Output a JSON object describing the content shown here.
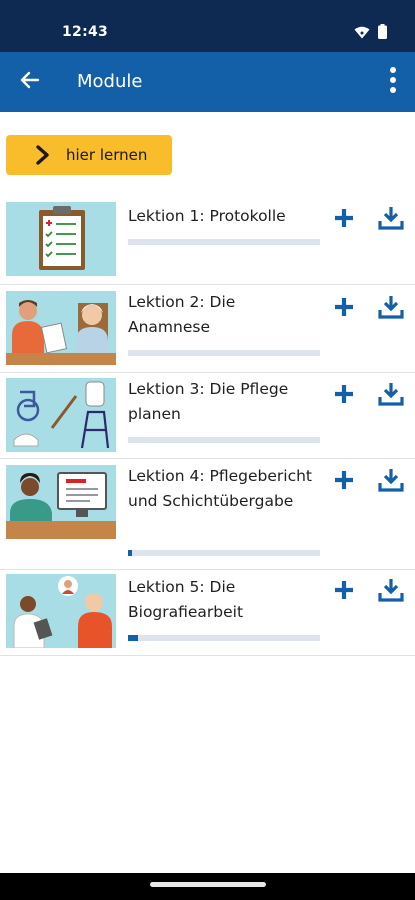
{
  "status_bar": {
    "time": "12:43",
    "icons": [
      "wifi-icon",
      "battery-icon"
    ]
  },
  "app_bar": {
    "title": "Module",
    "back_icon": "arrow-left-icon",
    "menu_icon": "more-vertical-icon"
  },
  "learn_button": {
    "label": "hier lernen",
    "icon": "chevron-right-icon"
  },
  "colors": {
    "primary": "#1460a8",
    "status_bar": "#0e2a52",
    "accent": "#f9bc2a",
    "thumbnail_bg": "#a9dde6"
  },
  "lessons": [
    {
      "title": "Lektion 1: Protokolle",
      "progress": 0.0,
      "image": "clipboard-checklist-illustration"
    },
    {
      "title": "Lektion 2: Die Anamnese",
      "progress": 0.0,
      "image": "nurse-interviewing-patient-illustration"
    },
    {
      "title": "Lektion 3: Die Pflege planen",
      "progress": 0.0,
      "image": "care-equipment-illustration"
    },
    {
      "title": "Lektion 4: Pflegebericht und Schichtübergabe",
      "progress": 0.02,
      "image": "nurse-at-computer-illustration"
    },
    {
      "title": "Lektion 5: Die Biografiearbeit",
      "progress": 0.05,
      "image": "biography-conversation-illustration"
    }
  ]
}
